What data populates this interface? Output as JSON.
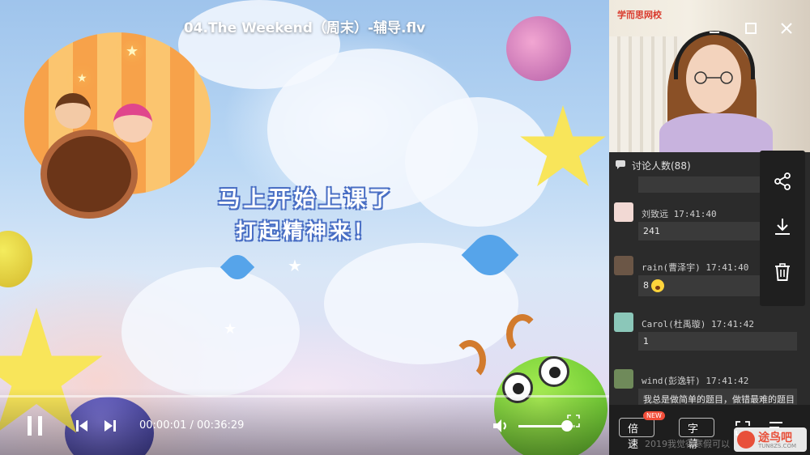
{
  "window": {
    "title": "04.The Weekend（周末）-辅导.flv"
  },
  "video": {
    "headline_line1": "马上开始上课了",
    "headline_line2": "打起精神来！",
    "progress_fraction": 0.0
  },
  "controls": {
    "current_time": "00:00:01",
    "separator": " / ",
    "duration": "00:36:29",
    "volume_fraction": 0.85,
    "icons": [
      "pause-icon",
      "previous-icon",
      "next-icon",
      "volume-icon",
      "expand-icon"
    ]
  },
  "camera": {
    "watermark": "学而思网校"
  },
  "chat": {
    "header": "讨论人数(88)",
    "messages": [
      {
        "user": "刘致远",
        "time": "17:41:40",
        "text": "241",
        "avatar_color": "#f2d9d4"
      },
      {
        "user": "rain(曹泽宇)",
        "time": "17:41:40",
        "text": "8",
        "emoji": true,
        "avatar_color": "#6b5646"
      },
      {
        "user": "Carol(杜禹璇)",
        "time": "17:41:42",
        "text": "1",
        "avatar_color": "#8bc7b9"
      },
      {
        "user": "wind(彭逸轩)",
        "time": "17:41:42",
        "text": "我总是做简单的题目，做错最难的题目",
        "avatar_color": "#6f8a5a"
      }
    ],
    "faded_text": "2019我觉得寒假可以"
  },
  "tools": {
    "icons": [
      "share-icon",
      "download-icon",
      "delete-icon"
    ]
  },
  "bottom": {
    "speed_label": "倍速",
    "new_badge": "NEW",
    "subtitle_label": "字幕"
  },
  "site_logo": {
    "name": "途鸟吧",
    "url_text": "TUN8ZS.COM"
  },
  "colors": {
    "accent_blue": "#4a8df0",
    "panel_bg": "#2b2b2b",
    "badge_red": "#f24e3a"
  }
}
